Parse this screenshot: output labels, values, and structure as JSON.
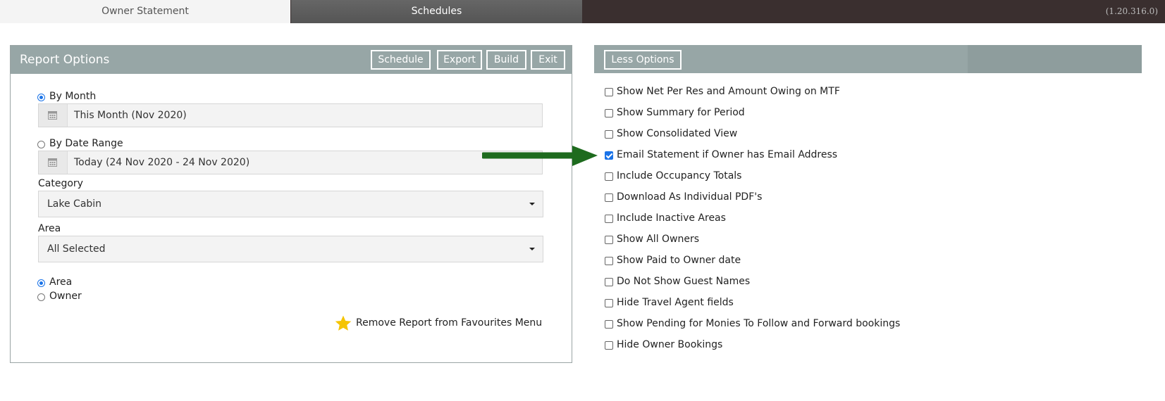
{
  "tabs": {
    "owner_statement": "Owner Statement",
    "schedules": "Schedules"
  },
  "version": "(1.20.316.0)",
  "report_options": {
    "title": "Report Options",
    "buttons": {
      "schedule": "Schedule",
      "export": "Export",
      "build": "Build",
      "exit": "Exit"
    },
    "by_month": {
      "label": "By Month",
      "selected": true,
      "value": "This Month (Nov 2020)"
    },
    "by_date_range": {
      "label": "By Date Range",
      "selected": false,
      "value": "Today (24 Nov 2020 - 24 Nov 2020)"
    },
    "category": {
      "label": "Category",
      "value": "Lake Cabin"
    },
    "area": {
      "label": "Area",
      "value": "All Selected"
    },
    "group_by": [
      {
        "label": "Area",
        "selected": true
      },
      {
        "label": "Owner",
        "selected": false
      }
    ],
    "favourites": "Remove Report from Favourites Menu"
  },
  "options_panel": {
    "less_options": "Less Options",
    "checkboxes": [
      {
        "label": "Show Net Per Res and Amount Owing on MTF",
        "checked": false
      },
      {
        "label": "Show Summary for Period",
        "checked": false
      },
      {
        "label": "Show Consolidated View",
        "checked": false
      },
      {
        "label": "Email Statement if Owner has Email Address",
        "checked": true
      },
      {
        "label": "Include Occupancy Totals",
        "checked": false
      },
      {
        "label": "Download As Individual PDF's",
        "checked": false
      },
      {
        "label": "Include Inactive Areas",
        "checked": false
      },
      {
        "label": "Show All Owners",
        "checked": false
      },
      {
        "label": "Show Paid to Owner date",
        "checked": false
      },
      {
        "label": "Do Not Show Guest Names",
        "checked": false
      },
      {
        "label": "Hide Travel Agent fields",
        "checked": false
      },
      {
        "label": "Show Pending for Monies To Follow and Forward bookings",
        "checked": false
      },
      {
        "label": "Hide Owner Bookings",
        "checked": false
      }
    ]
  },
  "colors": {
    "header": "#97a6a6",
    "topbar": "#3a2f2f",
    "arrow": "#1e6b1e",
    "star": "#f5c400",
    "accent": "#1a73e8"
  },
  "icons": [
    "calendar-icon",
    "chevron-down-icon",
    "star-icon",
    "arrow-right-icon"
  ]
}
